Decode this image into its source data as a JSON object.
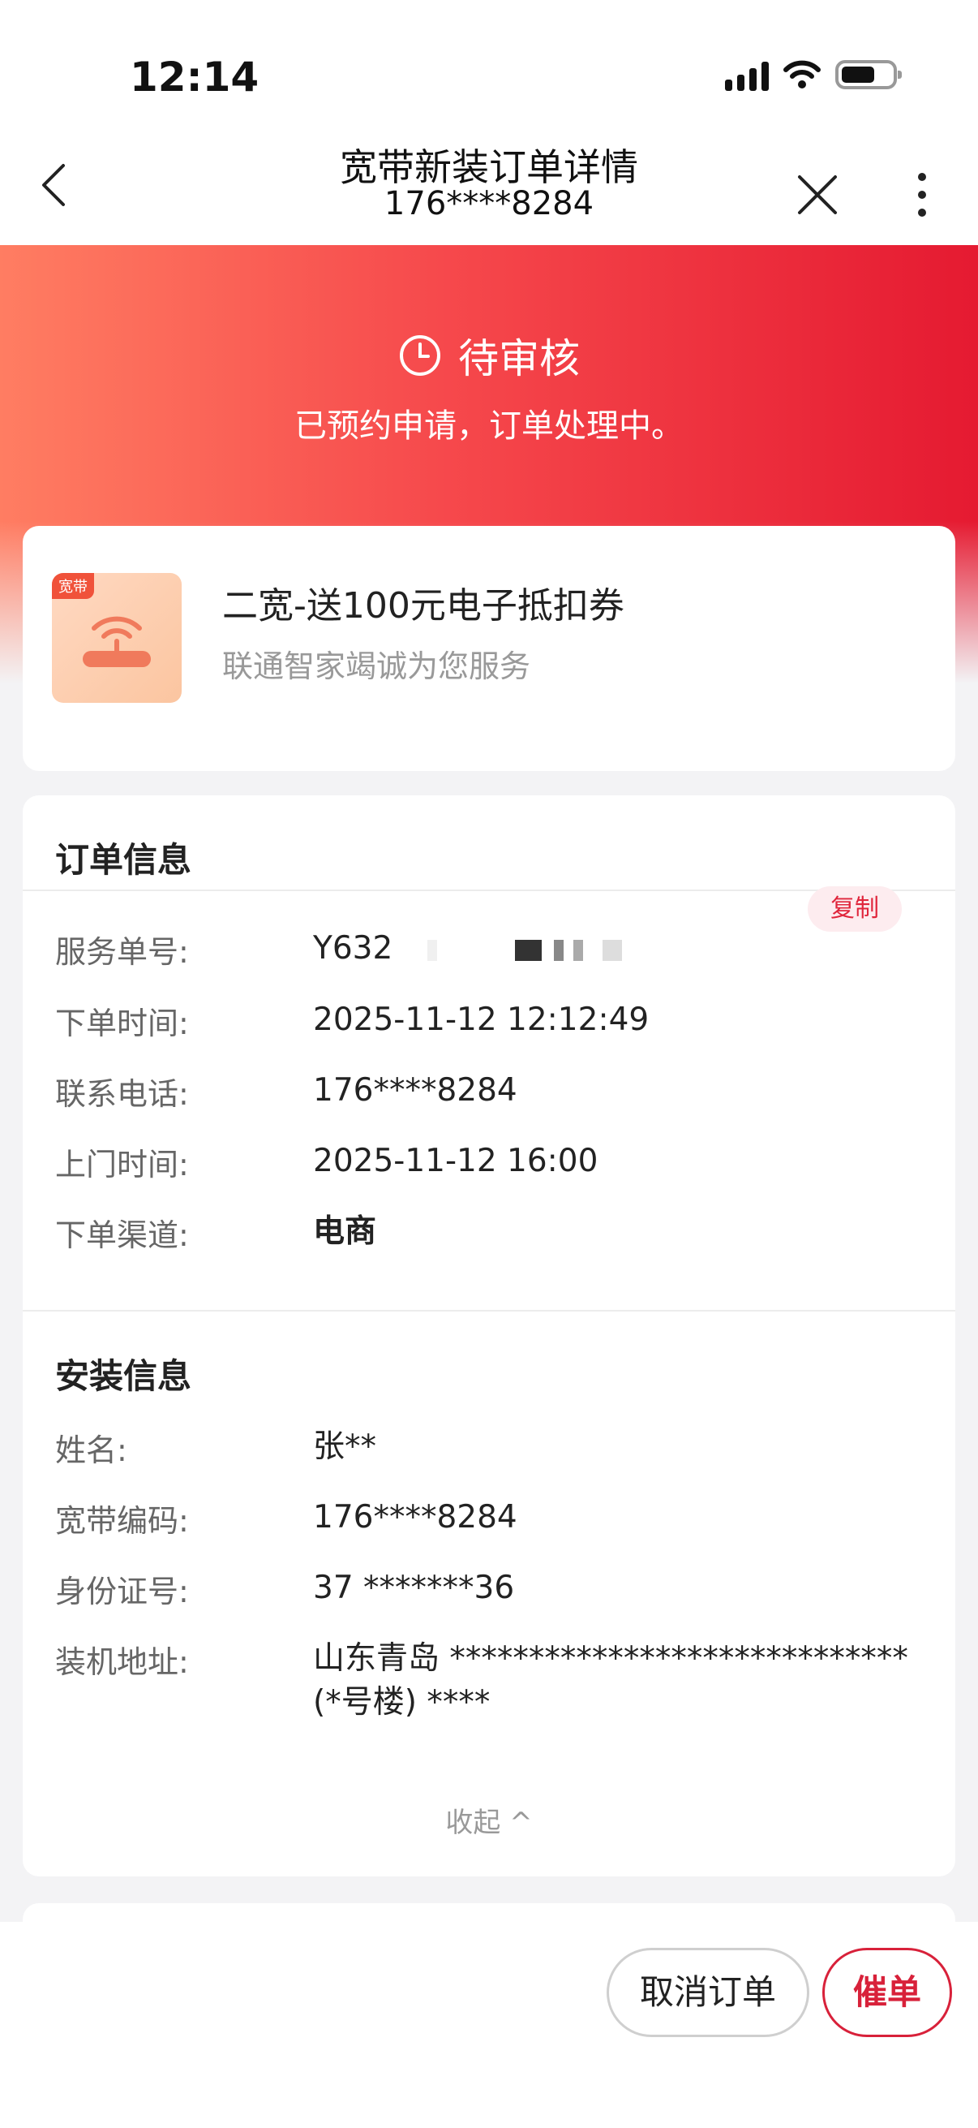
{
  "status_bar": {
    "time": "12:14"
  },
  "nav": {
    "title": "宽带新装订单详情",
    "subtitle": "176****8284"
  },
  "order_status": {
    "label": "待审核",
    "description": "已预约申请，订单处理中。"
  },
  "product": {
    "tag": "宽带",
    "name": "二宽-送100元电子抵扣券",
    "subtitle": "联通智家竭诚为您服务"
  },
  "order_info": {
    "title": "订单信息",
    "copy_label": "复制",
    "rows": [
      {
        "label": "服务单号:",
        "value": "Y632"
      },
      {
        "label": "下单时间:",
        "value": "2025-11-12 12:12:49"
      },
      {
        "label": "联系电话:",
        "value": "176****8284"
      },
      {
        "label": "上门时间:",
        "value": "2025-11-12 16:00"
      },
      {
        "label": "下单渠道:",
        "value": "电商"
      }
    ]
  },
  "install_info": {
    "title": "安装信息",
    "rows": [
      {
        "label": "姓名:",
        "value": "张**"
      },
      {
        "label": "宽带编码:",
        "value": "176****8284"
      },
      {
        "label": "身份证号:",
        "value": "37  *******36"
      },
      {
        "label": "装机地址:",
        "value": "山东青岛 ***************************** (*号楼) ****"
      }
    ],
    "collapse_label": "收起 ^"
  },
  "actions": {
    "cancel_label": "取消订单",
    "urge_label": "催单"
  },
  "colors": {
    "accent": "#e51a31",
    "banner_start": "#ff7d62",
    "banner_end": "#e51a31"
  }
}
